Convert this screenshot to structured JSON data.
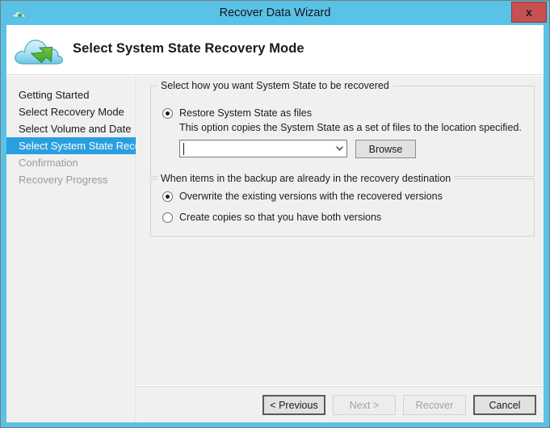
{
  "window": {
    "title": "Recover Data Wizard",
    "title_icon": "cloud-icon",
    "close_label": "x",
    "frame_color": "#5bc2e7",
    "close_button_color": "#c75050"
  },
  "header": {
    "title": "Select System State Recovery Mode",
    "icon": "cloud-recovery-icon"
  },
  "sidebar": {
    "items": [
      {
        "label": "Getting Started",
        "state": "normal"
      },
      {
        "label": "Select Recovery Mode",
        "state": "normal"
      },
      {
        "label": "Select Volume and Date",
        "state": "normal"
      },
      {
        "label": "Select System State Reco...",
        "state": "selected"
      },
      {
        "label": "Confirmation",
        "state": "disabled"
      },
      {
        "label": "Recovery Progress",
        "state": "disabled"
      }
    ],
    "selected_color": "#2a9fe0"
  },
  "main": {
    "recovery_mode_group": {
      "legend": "Select how you want System State to be recovered",
      "option": {
        "label": "Restore System State as files",
        "checked": true
      },
      "helper_text": "This option copies the System State as a set of files to the location specified.",
      "location_combobox": {
        "value": "",
        "placeholder": "",
        "has_caret": true
      },
      "browse_button": "Browse"
    },
    "conflict_group": {
      "legend": "When items in the backup are already in the recovery destination",
      "options": [
        {
          "label": "Overwrite the existing versions with the recovered versions",
          "checked": true
        },
        {
          "label": "Create copies so that you have both versions",
          "checked": false
        }
      ]
    }
  },
  "footer": {
    "buttons": [
      {
        "label": "< Previous",
        "enabled": true,
        "default": true
      },
      {
        "label": "Next >",
        "enabled": false,
        "default": false
      },
      {
        "label": "Recover",
        "enabled": false,
        "default": false
      },
      {
        "label": "Cancel",
        "enabled": true,
        "default": true
      }
    ]
  }
}
